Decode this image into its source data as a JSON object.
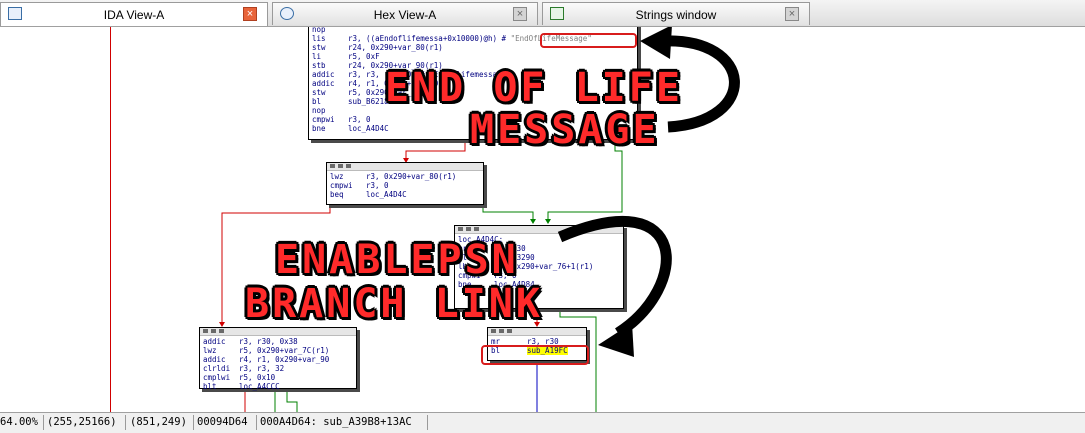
{
  "tabs": [
    {
      "label": "IDA View-A",
      "icon": "ida-view-icon",
      "active": true
    },
    {
      "label": "Hex View-A",
      "icon": "hex-view-icon",
      "active": false
    },
    {
      "label": "Strings window",
      "icon": "strings-icon",
      "active": false
    }
  ],
  "close_glyph": "×",
  "blocks": {
    "b1": [
      {
        "m": "nop",
        "o": ""
      },
      {
        "m": "lis",
        "o": "r3, ((aEndoflifemessa+0x10000)@h) # ",
        "s": "\"EndOfLifeMessage\""
      },
      {
        "m": "stw",
        "o": "r24, 0x290+var_80(r1)"
      },
      {
        "m": "li",
        "o": "r5, 0xF"
      },
      {
        "m": "stb",
        "o": "r24, 0x290+var_90(r1)"
      },
      {
        "m": "addic",
        "o": "r3, r3, -0x4004 # aEndoflifemessa"
      },
      {
        "m": "addic",
        "o": "r4, r1, 0x290+var_90"
      },
      {
        "m": "stw",
        "o": "r5, 0x290+var_7C(r1)"
      },
      {
        "m": "bl",
        "o": "sub_B6218"
      },
      {
        "m": "nop",
        "o": ""
      },
      {
        "m": "cmpwi",
        "o": "r3, 0"
      },
      {
        "m": "bne",
        "o": "loc_A4D4C"
      }
    ],
    "b2": [
      {
        "m": "lwz",
        "o": "r3, 0x290+var_80(r1)"
      },
      {
        "m": "cmpwi",
        "o": "r3, 0"
      },
      {
        "m": "beq",
        "o": "loc_A4D4C"
      }
    ],
    "b3": [
      {
        "m": "loc_A4D4C:",
        "o": ""
      },
      {
        "m": "mr",
        "o": "r3, r30"
      },
      {
        "m": "bl",
        "o": "sub_A3290"
      },
      {
        "m": "lbz",
        "o": "r3, 0x290+var_76+1(r1)"
      },
      {
        "m": "cmpwi",
        "o": "r3, 0"
      },
      {
        "m": "bne",
        "o": "loc_A4D84"
      }
    ],
    "b4": [
      {
        "m": "addic",
        "o": "r3, r30, 0x38"
      },
      {
        "m": "lwz",
        "o": "r5, 0x290+var_7C(r1)"
      },
      {
        "m": "addic",
        "o": "r4, r1, 0x290+var_90"
      },
      {
        "m": "clrldi",
        "o": "r3, r3, 32"
      },
      {
        "m": "cmplwi",
        "o": "r5, 0x10"
      },
      {
        "m": "blt",
        "o": "loc_A4CCC"
      }
    ],
    "b5": [
      {
        "m": "mr",
        "o": "r3, r30"
      },
      {
        "m": "bl",
        "o": "sub_A19FC",
        "hl": true
      }
    ]
  },
  "annotations": {
    "end_of_life": "END OF LIFE",
    "message": "MESSAGE",
    "enablepsn": "ENABLEPSN",
    "branch_link": "BRANCH LINK"
  },
  "status": {
    "zoom": "64.00%",
    "coords1": "(255,25166)",
    "coords2": "(851,249)",
    "offset": "00094D64",
    "location": "000A4D64: sub_A39B8+13AC"
  },
  "colors": {
    "accent_red": "#ff2a2a",
    "edge_red": "#d00000",
    "edge_green": "#008000",
    "edge_blue": "#0000c0"
  }
}
